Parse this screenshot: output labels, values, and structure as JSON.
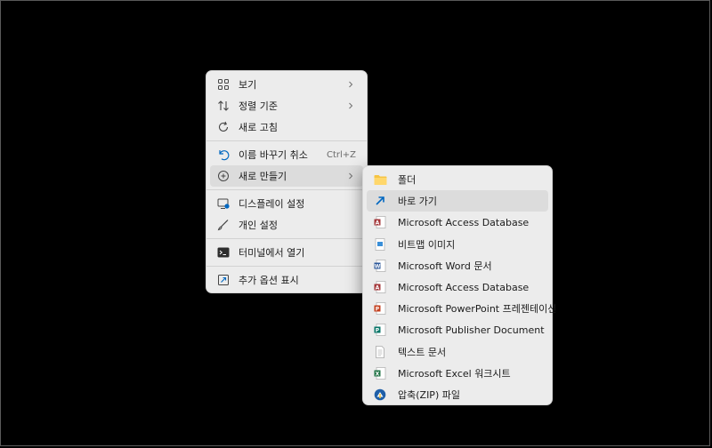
{
  "main_menu": {
    "items": [
      {
        "label": "보기",
        "icon": "view-icon"
      },
      {
        "label": "정렬 기준",
        "icon": "sort-icon"
      },
      {
        "label": "새로 고침",
        "icon": "refresh-icon"
      },
      {
        "label": "이름 바꾸기 취소",
        "shortcut": "Ctrl+Z",
        "icon": "undo-icon"
      },
      {
        "label": "새로 만들기",
        "icon": "new-icon"
      },
      {
        "label": "디스플레이 설정",
        "icon": "display-icon"
      },
      {
        "label": "개인 설정",
        "icon": "brush-icon"
      },
      {
        "label": "터미널에서 열기",
        "icon": "terminal-icon"
      },
      {
        "label": "추가 옵션 표시",
        "icon": "more-options-icon"
      }
    ]
  },
  "sub_menu": {
    "items": [
      {
        "label": "폴더",
        "icon": "folder-icon"
      },
      {
        "label": "바로 가기",
        "icon": "shortcut-icon"
      },
      {
        "label": "Microsoft Access Database",
        "icon": "access-icon"
      },
      {
        "label": "비트맵 이미지",
        "icon": "bitmap-icon"
      },
      {
        "label": "Microsoft Word 문서",
        "icon": "word-icon"
      },
      {
        "label": "Microsoft Access Database",
        "icon": "access-icon"
      },
      {
        "label": "Microsoft PowerPoint 프레젠테이션",
        "icon": "powerpoint-icon"
      },
      {
        "label": "Microsoft Publisher Document",
        "icon": "publisher-icon"
      },
      {
        "label": "텍스트 문서",
        "icon": "text-document-icon"
      },
      {
        "label": "Microsoft Excel 워크시트",
        "icon": "excel-icon"
      },
      {
        "label": "압축(ZIP) 파일",
        "icon": "zip-icon"
      }
    ]
  },
  "colors": {
    "background": "#000000",
    "menu_bg": "#ececec",
    "hover_bg": "#dcdcdc",
    "accent_blue": "#0067c0",
    "word_blue": "#2b579a",
    "excel_green": "#217346",
    "powerpoint_orange": "#c43e1c",
    "access_red": "#a4373a",
    "publisher_teal": "#077568",
    "folder_yellow": "#f6c443"
  }
}
